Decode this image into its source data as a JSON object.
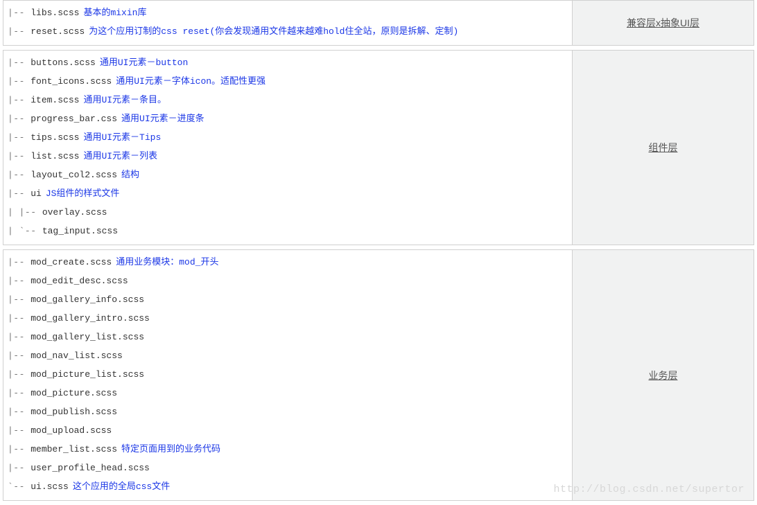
{
  "watermark": "http://blog.csdn.net/supertor",
  "sections": [
    {
      "label": "兼容层x抽象UI层",
      "lines": [
        {
          "prefix": "|-- ",
          "file": "libs.scss",
          "desc": "基本的mixin库"
        },
        {
          "prefix": "|-- ",
          "file": "reset.scss",
          "desc": "为这个应用订制的css reset(你会发现通用文件越来越难hold住全站，原则是拆解、定制)"
        }
      ]
    },
    {
      "label": "组件层",
      "lines": [
        {
          "prefix": "|-- ",
          "file": "buttons.scss",
          "desc": "通用UI元素－button"
        },
        {
          "prefix": "|-- ",
          "file": "font_icons.scss",
          "desc": "通用UI元素－字体icon。适配性更强"
        },
        {
          "prefix": "|-- ",
          "file": "item.scss",
          "desc": "通用UI元素－条目。"
        },
        {
          "prefix": "|-- ",
          "file": "progress_bar.css",
          "desc": "通用UI元素－进度条"
        },
        {
          "prefix": "|-- ",
          "file": "tips.scss",
          "desc": "通用UI元素－Tips"
        },
        {
          "prefix": "|-- ",
          "file": "list.scss",
          "desc": "通用UI元素－列表"
        },
        {
          "prefix": "|-- ",
          "file": "layout_col2.scss",
          "desc": "结构"
        },
        {
          "prefix": "|-- ",
          "file": "ui",
          "desc": "JS组件的样式文件"
        },
        {
          "prefix": "|   |-- ",
          "file": "overlay.scss",
          "desc": ""
        },
        {
          "prefix": "|   `-- ",
          "file": "tag_input.scss",
          "desc": ""
        }
      ]
    },
    {
      "label": "业务层",
      "lines": [
        {
          "prefix": "|-- ",
          "file": "mod_create.scss",
          "desc": "通用业务模块：mod_开头"
        },
        {
          "prefix": "|-- ",
          "file": "mod_edit_desc.scss",
          "desc": ""
        },
        {
          "prefix": "|-- ",
          "file": "mod_gallery_info.scss",
          "desc": ""
        },
        {
          "prefix": "|-- ",
          "file": "mod_gallery_intro.scss",
          "desc": ""
        },
        {
          "prefix": "|-- ",
          "file": "mod_gallery_list.scss",
          "desc": ""
        },
        {
          "prefix": "|-- ",
          "file": "mod_nav_list.scss",
          "desc": ""
        },
        {
          "prefix": "|-- ",
          "file": "mod_picture_list.scss",
          "desc": ""
        },
        {
          "prefix": "|-- ",
          "file": "mod_picture.scss",
          "desc": ""
        },
        {
          "prefix": "|-- ",
          "file": "mod_publish.scss",
          "desc": ""
        },
        {
          "prefix": "|-- ",
          "file": "mod_upload.scss",
          "desc": ""
        },
        {
          "prefix": "|-- ",
          "file": "member_list.scss",
          "desc": "特定页面用到的业务代码"
        },
        {
          "prefix": "|-- ",
          "file": "user_profile_head.scss",
          "desc": ""
        },
        {
          "prefix": "`-- ",
          "file": "ui.scss",
          "desc": "这个应用的全局css文件"
        }
      ]
    }
  ]
}
